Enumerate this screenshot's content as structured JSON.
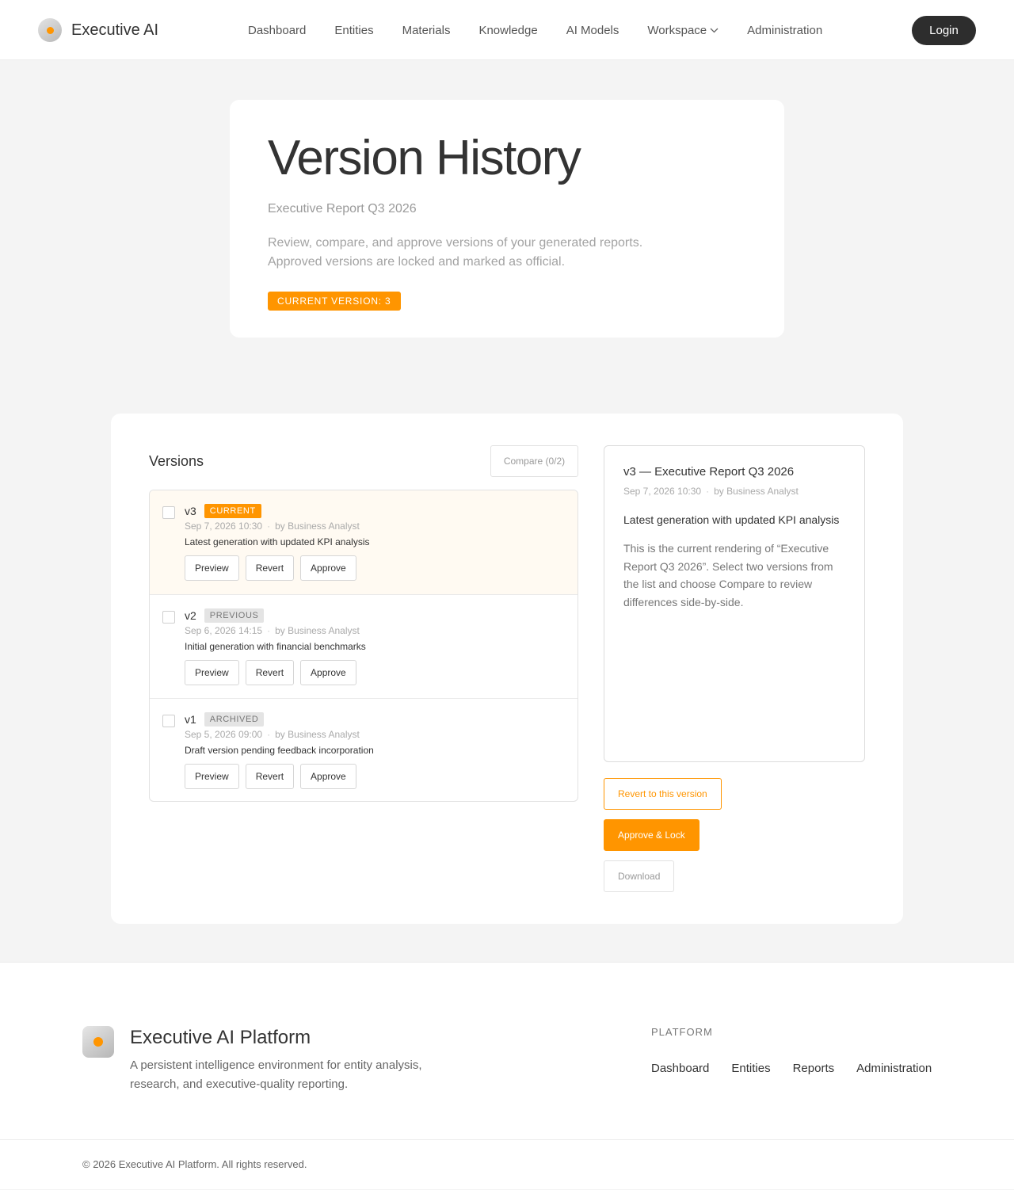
{
  "header": {
    "brand": "Executive AI",
    "nav": [
      {
        "label": "Dashboard"
      },
      {
        "label": "Entities"
      },
      {
        "label": "Materials"
      },
      {
        "label": "Knowledge"
      },
      {
        "label": "AI Models"
      },
      {
        "label": "Workspace"
      },
      {
        "label": "Administration"
      }
    ],
    "login": "Login"
  },
  "hero": {
    "title": "Version History",
    "subtitle": "Executive Report Q3 2026",
    "description": "Review, compare, and approve versions of your generated reports. Approved versions are locked and marked as official.",
    "badge": "CURRENT VERSION: 3"
  },
  "versions": {
    "title": "Versions",
    "compare_label": "Compare (0/2)",
    "items": [
      {
        "num": "v3",
        "badge": "CURRENT",
        "date": "Sep 7, 2026 10:30",
        "author": "by Business Analyst",
        "desc": "Latest generation with updated KPI analysis"
      },
      {
        "num": "v2",
        "badge": "PREVIOUS",
        "date": "Sep 6, 2026 14:15",
        "author": "by Business Analyst",
        "desc": "Initial generation with financial benchmarks"
      },
      {
        "num": "v1",
        "badge": "ARCHIVED",
        "date": "Sep 5, 2026 09:00",
        "author": "by Business Analyst",
        "desc": "Draft version pending feedback incorporation"
      }
    ],
    "actions": {
      "preview": "Preview",
      "revert": "Revert",
      "approve": "Approve"
    },
    "separator": "·"
  },
  "preview": {
    "title": "v3 — Executive Report Q3 2026",
    "date": "Sep 7, 2026 10:30",
    "author": "by Business Analyst",
    "headline": "Latest generation with updated KPI analysis",
    "body": "This is the current rendering of  “Executive Report Q3 2026”. Select two versions from the list and choose Compare to review differences side-by-side.",
    "revert": "Revert to this version",
    "approve": "Approve & Lock",
    "download": "Download"
  },
  "footer": {
    "title": "Executive AI Platform",
    "description": "A persistent intelligence environment for entity analysis, research, and executive-quality reporting.",
    "section": "PLATFORM",
    "links": [
      {
        "label": "Dashboard"
      },
      {
        "label": "Entities"
      },
      {
        "label": "Reports"
      },
      {
        "label": "Administration"
      }
    ],
    "copyright": "© 2026 Executive AI Platform. All rights reserved."
  },
  "colors": {
    "accent": "#ff9500",
    "dark": "#2d2d2d",
    "background": "#f4f4f4"
  }
}
